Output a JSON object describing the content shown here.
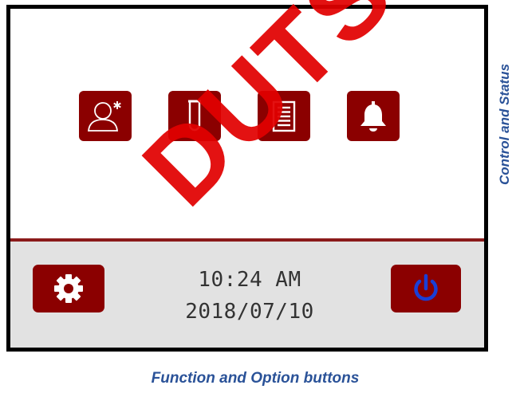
{
  "screen": {
    "function_buttons": [
      {
        "icon": "user-settings-icon"
      },
      {
        "icon": "test-tube-icon"
      },
      {
        "icon": "list-document-icon"
      },
      {
        "icon": "bell-icon"
      }
    ],
    "bottom_bar": {
      "settings_icon": "gear-icon",
      "time": "10:24 AM",
      "date": "2018/07/10",
      "power_icon": "power-icon"
    }
  },
  "labels": {
    "side": "Control and Status",
    "bottom": "Function and Option buttons"
  },
  "watermark": {
    "text": "DUTSCHER"
  },
  "colors": {
    "button_bg": "#8b0000",
    "divider": "#8b1a1a",
    "bottom_bar_bg": "#e2e2e2",
    "power_icon": "#1a3fd6",
    "label_text": "#2a5298",
    "watermark": "#e00000"
  }
}
